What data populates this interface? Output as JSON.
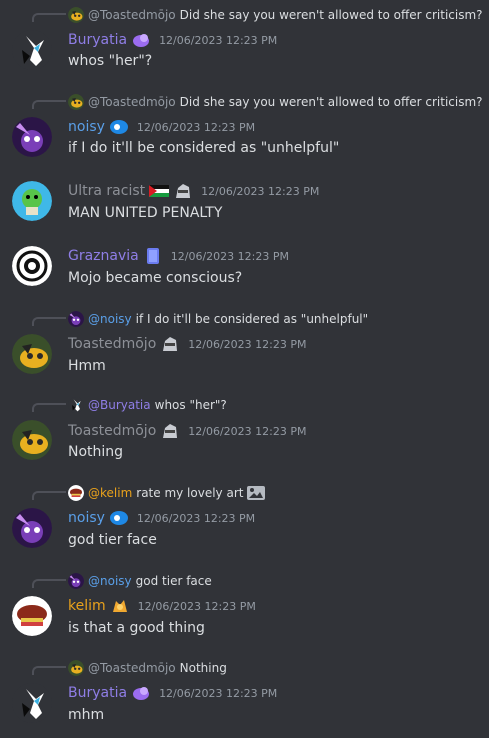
{
  "colors": {
    "background": "#313338",
    "text": "#dbdee1",
    "muted": "#949ba4",
    "purple_name": "#8f7ee6",
    "blue_name": "#5a9fe8",
    "gray_name": "#8d9097",
    "gold_name": "#e8a11c"
  },
  "messages": [
    {
      "reply": {
        "mention": "@Toastedmōjo",
        "text": "Did she say you weren't allowed to offer criticism?"
      },
      "author": "Buryatia",
      "timestamp": "12/06/2023 12:23 PM",
      "content": "whos \"her\"?"
    },
    {
      "reply": {
        "mention": "@Toastedmōjo",
        "text": "Did she say you weren't allowed to offer criticism?"
      },
      "author": "noisy",
      "timestamp": "12/06/2023 12:23 PM",
      "content": "if I do it'll be considered as \"unhelpful\""
    },
    {
      "author": "Ultra racist",
      "timestamp": "12/06/2023 12:23 PM",
      "content": "MAN UNITED PENALTY"
    },
    {
      "author": "Graznavia",
      "timestamp": "12/06/2023 12:23 PM",
      "content": "Mojo became conscious?"
    },
    {
      "reply": {
        "mention": "@noisy",
        "text": "if I do it'll be considered as \"unhelpful\""
      },
      "author": "Toastedmōjo",
      "timestamp": "12/06/2023 12:23 PM",
      "content": "Hmm"
    },
    {
      "reply": {
        "mention": "@Buryatia",
        "text": "whos \"her\"?"
      },
      "author": "Toastedmōjo",
      "timestamp": "12/06/2023 12:23 PM",
      "content": "Nothing"
    },
    {
      "reply": {
        "mention": "@kelim",
        "text": "rate my lovely art"
      },
      "author": "noisy",
      "timestamp": "12/06/2023 12:23 PM",
      "content": "god tier face"
    },
    {
      "reply": {
        "mention": "@noisy",
        "text": "god tier face"
      },
      "author": "kelim",
      "timestamp": "12/06/2023 12:23 PM",
      "content": "is that a good thing"
    },
    {
      "reply": {
        "mention": "@Toastedmōjo",
        "text": "Nothing"
      },
      "author": "Buryatia",
      "timestamp": "12/06/2023 12:23 PM",
      "content": "mhm"
    }
  ]
}
